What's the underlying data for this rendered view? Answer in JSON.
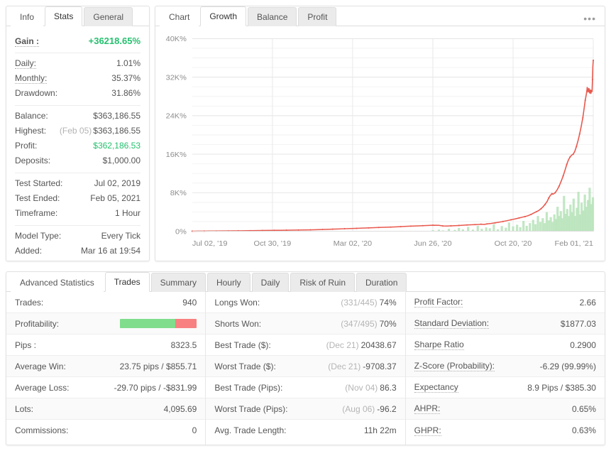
{
  "left_panel": {
    "tabs": [
      {
        "label": "Info",
        "active": false,
        "blank": true
      },
      {
        "label": "Stats",
        "active": true,
        "blank": false
      },
      {
        "label": "General",
        "active": false,
        "blank": false
      }
    ],
    "groups": [
      {
        "rows": [
          {
            "label": "Gain :",
            "value": "+36218.65%",
            "style": "green-bold",
            "dotted": true
          }
        ]
      },
      {
        "rows": [
          {
            "label": "Daily:",
            "value": "1.01%",
            "dotted": true
          },
          {
            "label": "Monthly:",
            "value": "35.37%",
            "dotted": true
          },
          {
            "label": "Drawdown:",
            "value": "31.86%",
            "dotted": false
          }
        ]
      },
      {
        "rows": [
          {
            "label": "Balance:",
            "value": "$363,186.55",
            "dotted": false
          },
          {
            "label": "Highest:",
            "muted": "(Feb 05)",
            "value": "$363,186.55",
            "dotted": false
          },
          {
            "label": "Profit:",
            "value": "$362,186.53",
            "style": "green",
            "dotted": false
          },
          {
            "label": "Deposits:",
            "value": "$1,000.00",
            "dotted": false
          }
        ]
      },
      {
        "rows": [
          {
            "label": "Test Started:",
            "value": "Jul 02, 2019",
            "dotted": false
          },
          {
            "label": "Test Ended:",
            "value": "Feb 05, 2021",
            "dotted": false
          },
          {
            "label": "Timeframe:",
            "value": "1 Hour",
            "dotted": false
          }
        ]
      },
      {
        "rows": [
          {
            "label": "Model Type:",
            "value": "Every Tick",
            "dotted": false
          },
          {
            "label": "Added:",
            "value": "Mar 16 at 19:54",
            "dotted": false
          }
        ]
      }
    ]
  },
  "chart_panel": {
    "tabs": [
      {
        "label": "Chart",
        "active": false,
        "blank": true
      },
      {
        "label": "Growth",
        "active": true,
        "blank": false
      },
      {
        "label": "Balance",
        "active": false,
        "blank": false
      },
      {
        "label": "Profit",
        "active": false,
        "blank": false
      }
    ],
    "menu_icon": "•••"
  },
  "chart_data": {
    "type": "line",
    "title": "Growth",
    "xlabel": "",
    "ylabel": "",
    "ylim": [
      0,
      40000
    ],
    "ytick_labels": [
      "0%",
      "8K%",
      "16K%",
      "24K%",
      "32K%",
      "40K%"
    ],
    "ytick_values": [
      0,
      8000,
      16000,
      24000,
      32000,
      40000
    ],
    "xtick_labels": [
      "Jul 02, '19",
      "Oct 30, '19",
      "Mar 02, '20",
      "Jun 26, '20",
      "Oct 20, '20",
      "Feb 01, '21"
    ],
    "grid": true,
    "legend": "none",
    "series": [
      {
        "name": "Growth",
        "color": "#e8594e",
        "unit": "%",
        "points": [
          [
            0.0,
            20
          ],
          [
            0.015,
            30
          ],
          [
            0.03,
            40
          ],
          [
            0.045,
            45
          ],
          [
            0.06,
            50
          ],
          [
            0.075,
            60
          ],
          [
            0.09,
            70
          ],
          [
            0.1,
            80
          ],
          [
            0.115,
            95
          ],
          [
            0.13,
            110
          ],
          [
            0.145,
            120
          ],
          [
            0.16,
            140
          ],
          [
            0.175,
            160
          ],
          [
            0.19,
            180
          ],
          [
            0.205,
            190
          ],
          [
            0.22,
            200
          ],
          [
            0.235,
            215
          ],
          [
            0.25,
            230
          ],
          [
            0.265,
            250
          ],
          [
            0.28,
            270
          ],
          [
            0.295,
            290
          ],
          [
            0.31,
            320
          ],
          [
            0.325,
            360
          ],
          [
            0.34,
            400
          ],
          [
            0.35,
            430
          ],
          [
            0.365,
            470
          ],
          [
            0.38,
            520
          ],
          [
            0.395,
            560
          ],
          [
            0.41,
            600
          ],
          [
            0.425,
            660
          ],
          [
            0.44,
            700
          ],
          [
            0.45,
            740
          ],
          [
            0.465,
            780
          ],
          [
            0.48,
            820
          ],
          [
            0.495,
            860
          ],
          [
            0.505,
            900
          ],
          [
            0.52,
            950
          ],
          [
            0.53,
            1000
          ],
          [
            0.545,
            1060
          ],
          [
            0.56,
            1100
          ],
          [
            0.575,
            1160
          ],
          [
            0.59,
            1210
          ],
          [
            0.6,
            1250
          ],
          [
            0.615,
            1230
          ],
          [
            0.625,
            1100
          ],
          [
            0.635,
            1080
          ],
          [
            0.645,
            1120
          ],
          [
            0.655,
            1160
          ],
          [
            0.665,
            1200
          ],
          [
            0.675,
            1250
          ],
          [
            0.685,
            1300
          ],
          [
            0.695,
            1340
          ],
          [
            0.705,
            1380
          ],
          [
            0.715,
            1420
          ],
          [
            0.72,
            1460
          ],
          [
            0.728,
            1420
          ],
          [
            0.735,
            1520
          ],
          [
            0.745,
            1620
          ],
          [
            0.755,
            1740
          ],
          [
            0.765,
            1880
          ],
          [
            0.775,
            2030
          ],
          [
            0.785,
            2200
          ],
          [
            0.795,
            2380
          ],
          [
            0.805,
            2560
          ],
          [
            0.815,
            2760
          ],
          [
            0.822,
            2900
          ],
          [
            0.83,
            3050
          ],
          [
            0.838,
            3250
          ],
          [
            0.845,
            3500
          ],
          [
            0.852,
            3800
          ],
          [
            0.858,
            4050
          ],
          [
            0.864,
            4300
          ],
          [
            0.87,
            4700
          ],
          [
            0.875,
            5100
          ],
          [
            0.88,
            5600
          ],
          [
            0.885,
            6200
          ],
          [
            0.889,
            6900
          ],
          [
            0.893,
            7450
          ],
          [
            0.897,
            7800
          ],
          [
            0.9,
            7700
          ],
          [
            0.905,
            8000
          ],
          [
            0.91,
            8600
          ],
          [
            0.915,
            9400
          ],
          [
            0.92,
            10400
          ],
          [
            0.925,
            11500
          ],
          [
            0.93,
            12800
          ],
          [
            0.934,
            13900
          ],
          [
            0.938,
            14800
          ],
          [
            0.942,
            15400
          ],
          [
            0.946,
            15800
          ],
          [
            0.95,
            16000
          ],
          [
            0.954,
            16600
          ],
          [
            0.958,
            17600
          ],
          [
            0.962,
            18800
          ],
          [
            0.966,
            20200
          ],
          [
            0.97,
            21800
          ],
          [
            0.974,
            23600
          ],
          [
            0.977,
            25400
          ],
          [
            0.98,
            27200
          ],
          [
            0.983,
            28600
          ],
          [
            0.985,
            29800
          ],
          [
            0.987,
            28900
          ],
          [
            0.989,
            29600
          ],
          [
            0.991,
            28700
          ],
          [
            0.9925,
            29300
          ],
          [
            0.994,
            28600
          ],
          [
            0.9955,
            29200
          ],
          [
            0.997,
            29000
          ],
          [
            0.998,
            31500
          ],
          [
            0.999,
            34300
          ],
          [
            1.0,
            35500
          ]
        ]
      }
    ],
    "volume_bars": {
      "name": "Trade volume",
      "color": "#b6e3b8",
      "values": [
        [
          0.6,
          40
        ],
        [
          0.615,
          60
        ],
        [
          0.625,
          30
        ],
        [
          0.64,
          90
        ],
        [
          0.655,
          50
        ],
        [
          0.665,
          120
        ],
        [
          0.675,
          70
        ],
        [
          0.688,
          160
        ],
        [
          0.7,
          60
        ],
        [
          0.712,
          200
        ],
        [
          0.722,
          90
        ],
        [
          0.733,
          140
        ],
        [
          0.742,
          110
        ],
        [
          0.752,
          260
        ],
        [
          0.762,
          70
        ],
        [
          0.772,
          190
        ],
        [
          0.782,
          130
        ],
        [
          0.79,
          320
        ],
        [
          0.8,
          180
        ],
        [
          0.81,
          240
        ],
        [
          0.818,
          150
        ],
        [
          0.826,
          380
        ],
        [
          0.834,
          200
        ],
        [
          0.842,
          300
        ],
        [
          0.85,
          420
        ],
        [
          0.856,
          260
        ],
        [
          0.862,
          560
        ],
        [
          0.868,
          340
        ],
        [
          0.874,
          480
        ],
        [
          0.879,
          300
        ],
        [
          0.884,
          700
        ],
        [
          0.889,
          400
        ],
        [
          0.894,
          520
        ],
        [
          0.899,
          340
        ],
        [
          0.903,
          620
        ],
        [
          0.907,
          450
        ],
        [
          0.911,
          900
        ],
        [
          0.915,
          560
        ],
        [
          0.919,
          740
        ],
        [
          0.923,
          480
        ],
        [
          0.927,
          1300
        ],
        [
          0.931,
          640
        ],
        [
          0.935,
          820
        ],
        [
          0.939,
          560
        ],
        [
          0.943,
          980
        ],
        [
          0.947,
          700
        ],
        [
          0.951,
          1200
        ],
        [
          0.955,
          560
        ],
        [
          0.959,
          860
        ],
        [
          0.963,
          1450
        ],
        [
          0.967,
          620
        ],
        [
          0.971,
          1050
        ],
        [
          0.975,
          760
        ],
        [
          0.979,
          1350
        ],
        [
          0.983,
          900
        ],
        [
          0.987,
          1150
        ],
        [
          0.991,
          1600
        ],
        [
          0.995,
          1000
        ],
        [
          0.999,
          1250
        ]
      ]
    }
  },
  "bottom_panel": {
    "tabs": [
      {
        "label": "Advanced Statistics",
        "active": false,
        "blank": true
      },
      {
        "label": "Trades",
        "active": true,
        "blank": false
      },
      {
        "label": "Summary",
        "active": false,
        "blank": false
      },
      {
        "label": "Hourly",
        "active": false,
        "blank": false
      },
      {
        "label": "Daily",
        "active": false,
        "blank": false
      },
      {
        "label": "Risk of Ruin",
        "active": false,
        "blank": false
      },
      {
        "label": "Duration",
        "active": false,
        "blank": false
      }
    ],
    "columns": [
      {
        "rows": [
          {
            "label": "Trades:",
            "value": "940",
            "dotted": false
          },
          {
            "label": "Profitability:",
            "value": "",
            "bar": {
              "win_pct": 72,
              "loss_pct": 28
            },
            "dotted": false
          },
          {
            "label": "Pips :",
            "value": "8323.5",
            "dotted": false
          },
          {
            "label": "Average Win:",
            "value": "23.75 pips / $855.71",
            "dotted": false
          },
          {
            "label": "Average Loss:",
            "value": "-29.70 pips / -$831.99",
            "dotted": false
          },
          {
            "label": "Lots:",
            "value": "4,095.69",
            "dotted": false
          },
          {
            "label": "Commissions:",
            "value": "0",
            "dotted": false
          }
        ]
      },
      {
        "rows": [
          {
            "label": "Longs Won:",
            "muted": "(331/445)",
            "value": "74%",
            "dotted": false
          },
          {
            "label": "Shorts Won:",
            "muted": "(347/495)",
            "value": "70%",
            "dotted": false
          },
          {
            "label": "Best Trade ($):",
            "muted": "(Dec 21)",
            "value": "20438.67",
            "dotted": false
          },
          {
            "label": "Worst Trade ($):",
            "muted": "(Dec 21)",
            "value": "-9708.37",
            "dotted": false
          },
          {
            "label": "Best Trade (Pips):",
            "muted": "(Nov 04)",
            "value": "86.3",
            "dotted": false
          },
          {
            "label": "Worst Trade (Pips):",
            "muted": "(Aug 06)",
            "value": "-96.2",
            "dotted": false
          },
          {
            "label": "Avg. Trade Length:",
            "value": "11h 22m",
            "dotted": false
          }
        ]
      },
      {
        "rows": [
          {
            "label": "Profit Factor:",
            "value": "2.66",
            "dotted": true
          },
          {
            "label": "Standard Deviation:",
            "value": "$1877.03",
            "dotted": true
          },
          {
            "label": "Sharpe Ratio",
            "value": "0.2900",
            "dotted": true
          },
          {
            "label": "Z-Score (Probability):",
            "value": "-6.29 (99.99%)",
            "dotted": true
          },
          {
            "label": "Expectancy",
            "value": "8.9 Pips / $385.30",
            "dotted": true
          },
          {
            "label": "AHPR:",
            "value": "0.65%",
            "dotted": true
          },
          {
            "label": "GHPR:",
            "value": "0.63%",
            "dotted": true
          }
        ]
      }
    ]
  }
}
